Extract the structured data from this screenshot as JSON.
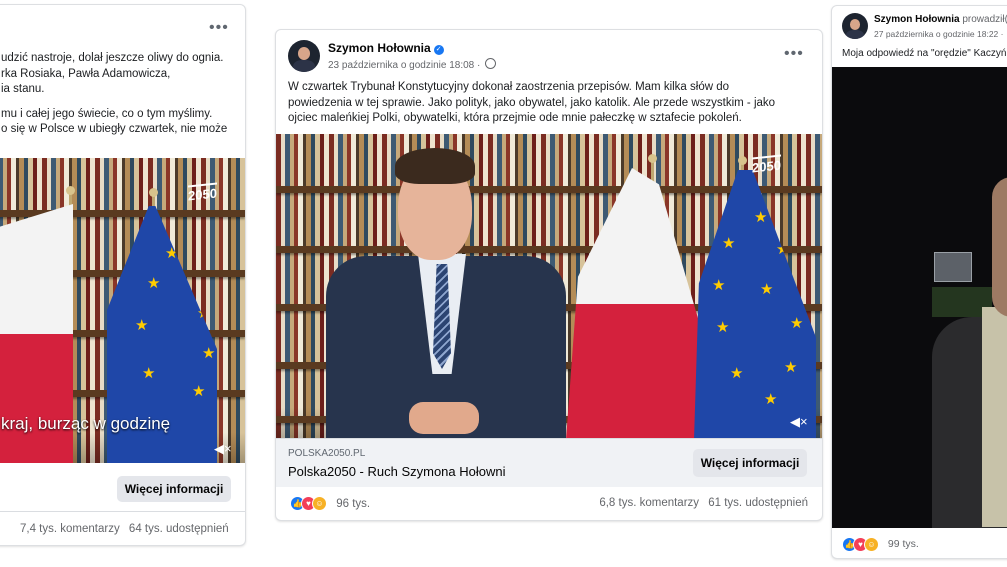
{
  "left_post": {
    "text_lines": [
      "udzić nastroje, dolał jeszcze oliwy do ognia.",
      "rka Rosiaka, Pawła Adamowicza,",
      "ia stanu.",
      "mu i całej jego świecie, co o tym myślimy.",
      "o się w Polsce w ubiegły czwartek, nie może"
    ],
    "subtitle": "kraj, burząc w godzinę",
    "logo": "2050",
    "more_button": "Więcej informacji",
    "comments": "7,4 tys. komentarzy",
    "shares": "64 tys. udostępnień"
  },
  "middle_post": {
    "author": "Szymon Hołownia",
    "timestamp": "23 października o godzinie 18:08 ·",
    "text": "W czwartek Trybunał Konstytucyjny dokonał zaostrzenia przepisów. Mam kilka słów do powiedzenia w tej sprawie. Jako polityk, jako obywatel, jako katolik. Ale przede wszystkim - jako ojciec maleńkiej Polki, obywatelki, która przejmie ode mnie pałeczkę w sztafecie pokoleń.",
    "logo": "2050",
    "link_domain": "POLSKA2050.PL",
    "link_title": "Polska2050 - Ruch Szymona Hołowni",
    "more_button": "Więcej informacji",
    "reactions_count": "96 tys.",
    "comments": "6,8 tys. komentarzy",
    "shares": "61 tys. udostępnień"
  },
  "right_post": {
    "author": "Szymon Hołownia",
    "author_suffix": "prowadził(",
    "timestamp": "27 października o godzinie 18:22 ·",
    "text": "Moja odpowiedź na \"orędzie\" Kaczyń",
    "reactions_count": "99 tys."
  },
  "colors": {
    "accent": "#1877f2",
    "flag_red": "#d4213d",
    "eu_blue": "#1f47a8",
    "eu_star": "#ffcc00"
  },
  "icons": {
    "menu": "more-horizontal-icon",
    "verified": "verified-badge-icon",
    "globe": "globe-icon",
    "volume": "volume-icon"
  }
}
